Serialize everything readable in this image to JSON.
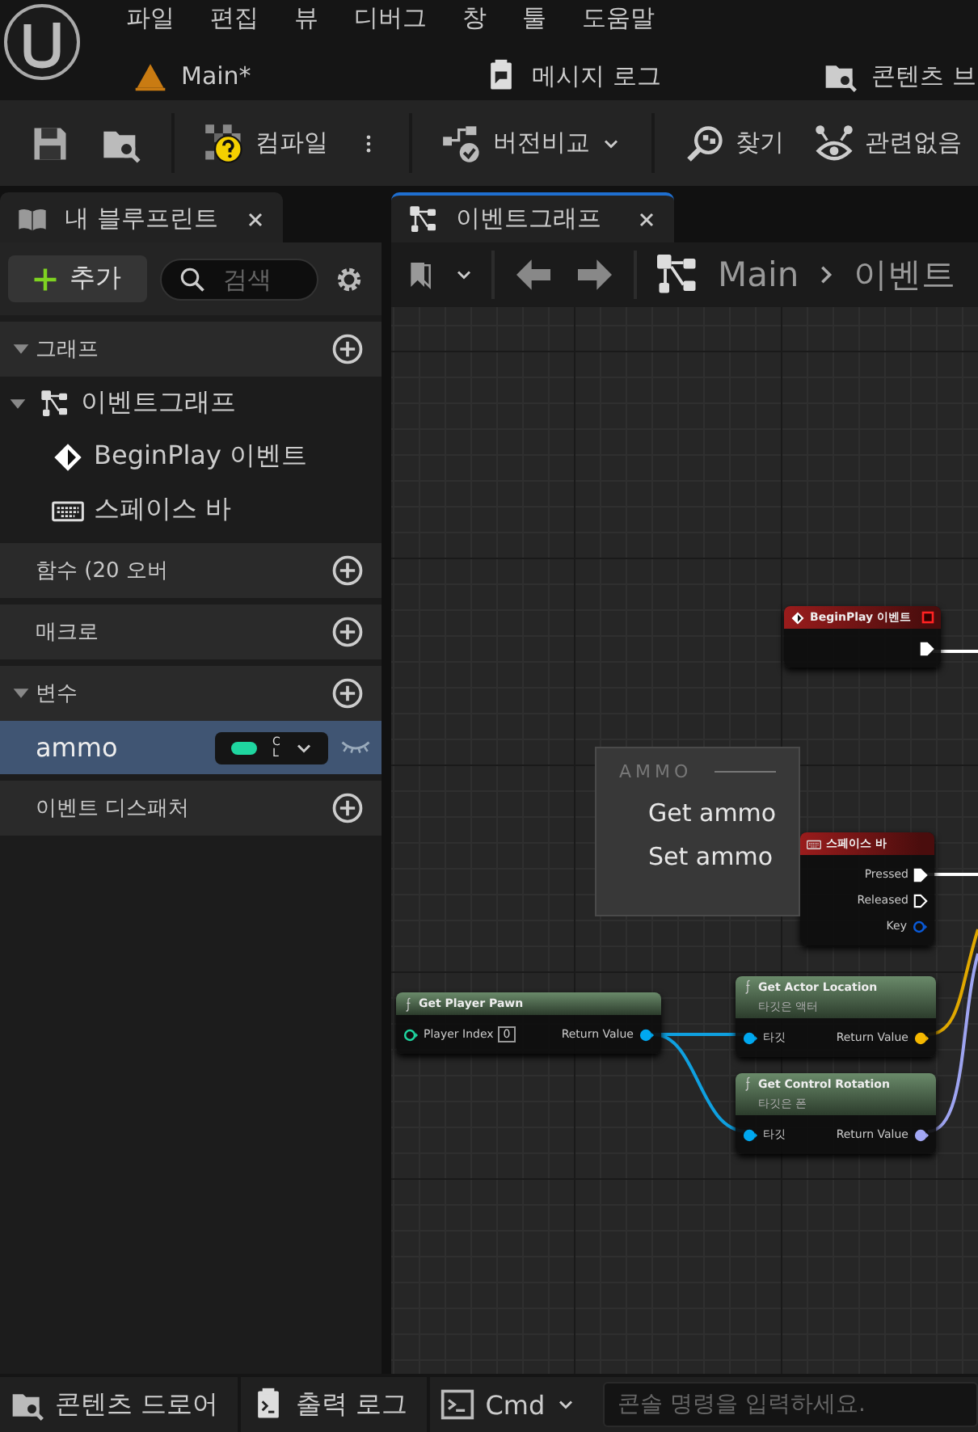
{
  "menu": [
    "파일",
    "편집",
    "뷰",
    "디버그",
    "창",
    "툴",
    "도움말"
  ],
  "document_tabs": [
    {
      "kind": "level",
      "label": "Main*"
    },
    {
      "kind": "log",
      "label": "메시지 로그"
    },
    {
      "kind": "browser",
      "label": "콘텐츠 브"
    }
  ],
  "toolbar": [
    {
      "items": [
        {
          "kind": "save"
        },
        {
          "kind": "browse"
        }
      ]
    },
    {
      "items": [
        {
          "kind": "compile",
          "label": "컴파일"
        },
        {
          "kind": "more"
        }
      ]
    },
    {
      "items": [
        {
          "kind": "diff",
          "label": "버전비교",
          "dropdown": true
        }
      ]
    },
    {
      "items": [
        {
          "kind": "find",
          "label": "찾기"
        },
        {
          "kind": "unrelated",
          "label": "관련없음"
        }
      ]
    }
  ],
  "blueprint_panel": {
    "tab": {
      "label": "내 블루프린트",
      "selected": false
    },
    "add_button": "추가",
    "search": {
      "placeholder": "검색"
    },
    "sections": [
      {
        "label": "그래프",
        "expanded": true,
        "items": [
          {
            "kind": "graph",
            "label": "이벤트그래프",
            "expanded": true,
            "children": [
              {
                "kind": "event",
                "label": "BeginPlay 이벤트"
              },
              {
                "kind": "key",
                "label": "스페이스 바"
              }
            ]
          }
        ]
      },
      {
        "label": "함수 (20 오버"
      },
      {
        "label": "매크로"
      },
      {
        "label": "변수",
        "expanded": true,
        "items": [
          {
            "kind": "variable",
            "label": "ammo",
            "selected": true,
            "type_label": "CL",
            "color": "#1fd6a0"
          }
        ]
      },
      {
        "label": "이벤트 디스패처"
      }
    ]
  },
  "graph_panel": {
    "tab": {
      "label": "이벤트그래프",
      "selected": true
    },
    "breadcrumb": [
      "Main",
      "이벤트"
    ],
    "context_menu": {
      "heading": "AMMO",
      "items": [
        "Get ammo",
        "Set ammo"
      ]
    },
    "nodes": [
      {
        "kind": "event",
        "title": "BeginPlay 이벤트",
        "outputs": [
          {
            "kind": "exec",
            "connected": true
          }
        ]
      },
      {
        "kind": "key_event",
        "title": "스페이스 바",
        "outputs": [
          {
            "kind": "exec",
            "label": "Pressed",
            "connected": true
          },
          {
            "kind": "exec",
            "label": "Released",
            "connected": false
          },
          {
            "kind": "struct",
            "label": "Key",
            "connected": false
          }
        ]
      },
      {
        "kind": "function",
        "title": "Get Player Pawn",
        "inputs": [
          {
            "kind": "int",
            "label": "Player Index",
            "value": "0",
            "connected": false
          }
        ],
        "outputs": [
          {
            "kind": "object",
            "label": "Return Value",
            "connected": true
          }
        ]
      },
      {
        "kind": "function",
        "title": "Get Actor Location",
        "subtitle": "타깃은 액터",
        "inputs": [
          {
            "kind": "object",
            "label": "타깃",
            "connected": true
          }
        ],
        "outputs": [
          {
            "kind": "vector",
            "label": "Return Value",
            "connected": true
          }
        ]
      },
      {
        "kind": "function",
        "title": "Get Control Rotation",
        "subtitle": "타깃은 폰",
        "inputs": [
          {
            "kind": "object",
            "label": "타깃",
            "connected": true
          }
        ],
        "outputs": [
          {
            "kind": "rotator",
            "label": "Return Value",
            "connected": true
          }
        ]
      }
    ]
  },
  "status_bar": {
    "items": [
      {
        "kind": "drawer",
        "label": "콘텐츠 드로어"
      },
      {
        "kind": "log",
        "label": "출력 로그"
      },
      {
        "kind": "cmd",
        "label": "Cmd",
        "dropdown": true
      }
    ],
    "console": {
      "placeholder": "콘솔 명령을 입력하세요."
    }
  }
}
